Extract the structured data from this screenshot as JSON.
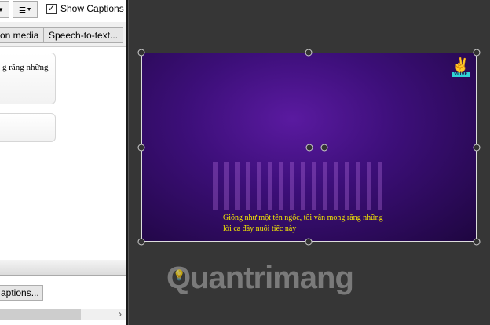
{
  "toolbar": {
    "show_captions_label": "Show Captions",
    "show_captions_checked": true,
    "align_icon": "align-icon",
    "dropdown_icon": "chevron-down-icon"
  },
  "buttons": {
    "on_media": "on media",
    "speech_to_text": "Speech-to-text...",
    "captions": "aptions..."
  },
  "captions": [
    {
      "text": "g rằng những"
    },
    {
      "text": ""
    }
  ],
  "video": {
    "subtitle_line1": "Giống như một tên ngốc, tôi vẫn mong rằng những",
    "subtitle_line2": "lời ca đầy nuối tiếc này",
    "logo": "VLIVE"
  },
  "watermark": "Quantrimang",
  "colors": {
    "subtitle": "#f2e600",
    "vlive": "#2fd5d5"
  }
}
